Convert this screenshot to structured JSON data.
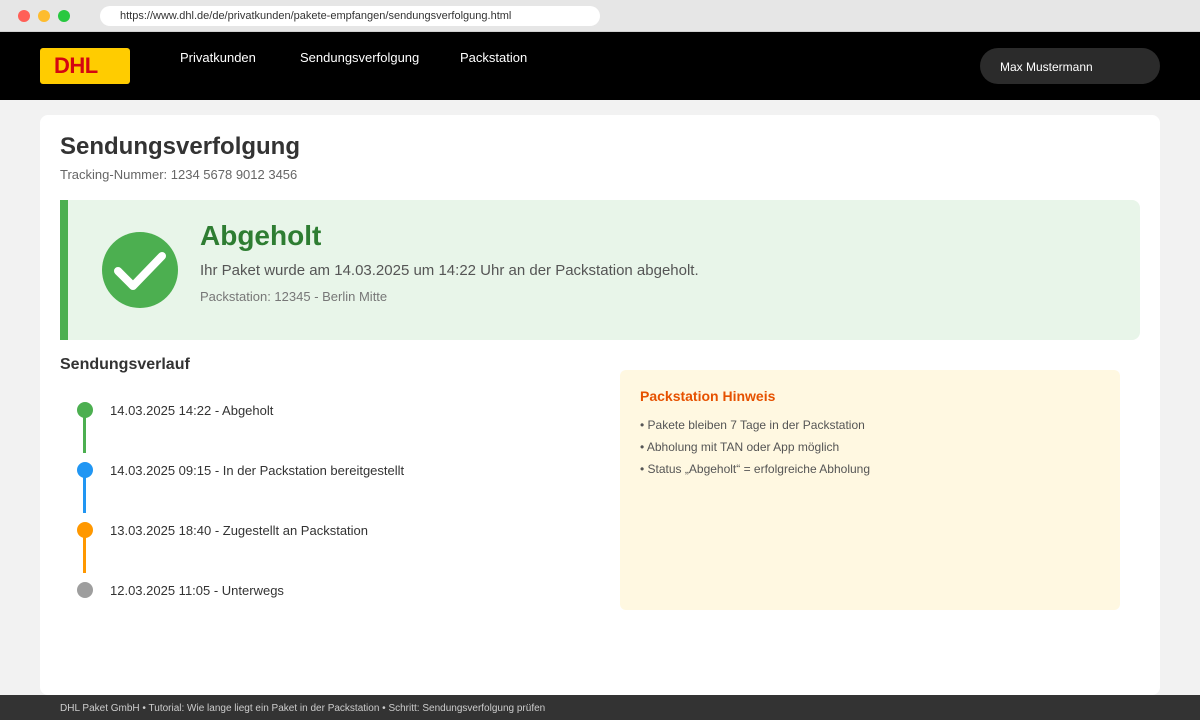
{
  "browser": {
    "url": "https://www.dhl.de/de/privatkunden/pakete-empfangen/sendungsverfolgung.html"
  },
  "header": {
    "logo": "DHL",
    "nav": [
      "Privatkunden",
      "Sendungsverfolgung",
      "Packstation"
    ],
    "user": "Max Mustermann"
  },
  "main": {
    "title": "Sendungsverfolgung",
    "tracking": "Tracking-Nummer: 1234 5678 9012 3456",
    "status": {
      "title": "Abgeholt",
      "description": "Ihr Paket wurde am 14.03.2025 um 14:22 Uhr an der Packstation abgeholt.",
      "station": "Packstation: 12345 - Berlin Mitte"
    },
    "history": {
      "title": "Sendungsverlauf",
      "events": [
        {
          "text": "14.03.2025 14:22 - Abgeholt",
          "color": "#4caf50"
        },
        {
          "text": "14.03.2025 09:15 - In der Packstation bereitgestellt",
          "color": "#2196f3"
        },
        {
          "text": "13.03.2025 18:40 - Zugestellt an Packstation",
          "color": "#ff9800"
        },
        {
          "text": "12.03.2025 11:05 - Unterwegs",
          "color": "#9e9e9e"
        }
      ]
    },
    "hint": {
      "title": "Packstation Hinweis",
      "items": [
        "• Pakete bleiben 7 Tage in der Packstation",
        "• Abholung mit TAN oder App möglich",
        "• Status „Abgeholt“ = erfolgreiche Abholung"
      ]
    }
  },
  "footer": {
    "text": "DHL Paket GmbH • Tutorial: Wie lange liegt ein Paket in der Packstation • Schritt: Sendungsverfolgung prüfen"
  },
  "colors": {
    "brand_yellow": "#ffcc00",
    "brand_red": "#d40511",
    "success": "#4caf50",
    "hint_accent": "#e65100"
  }
}
